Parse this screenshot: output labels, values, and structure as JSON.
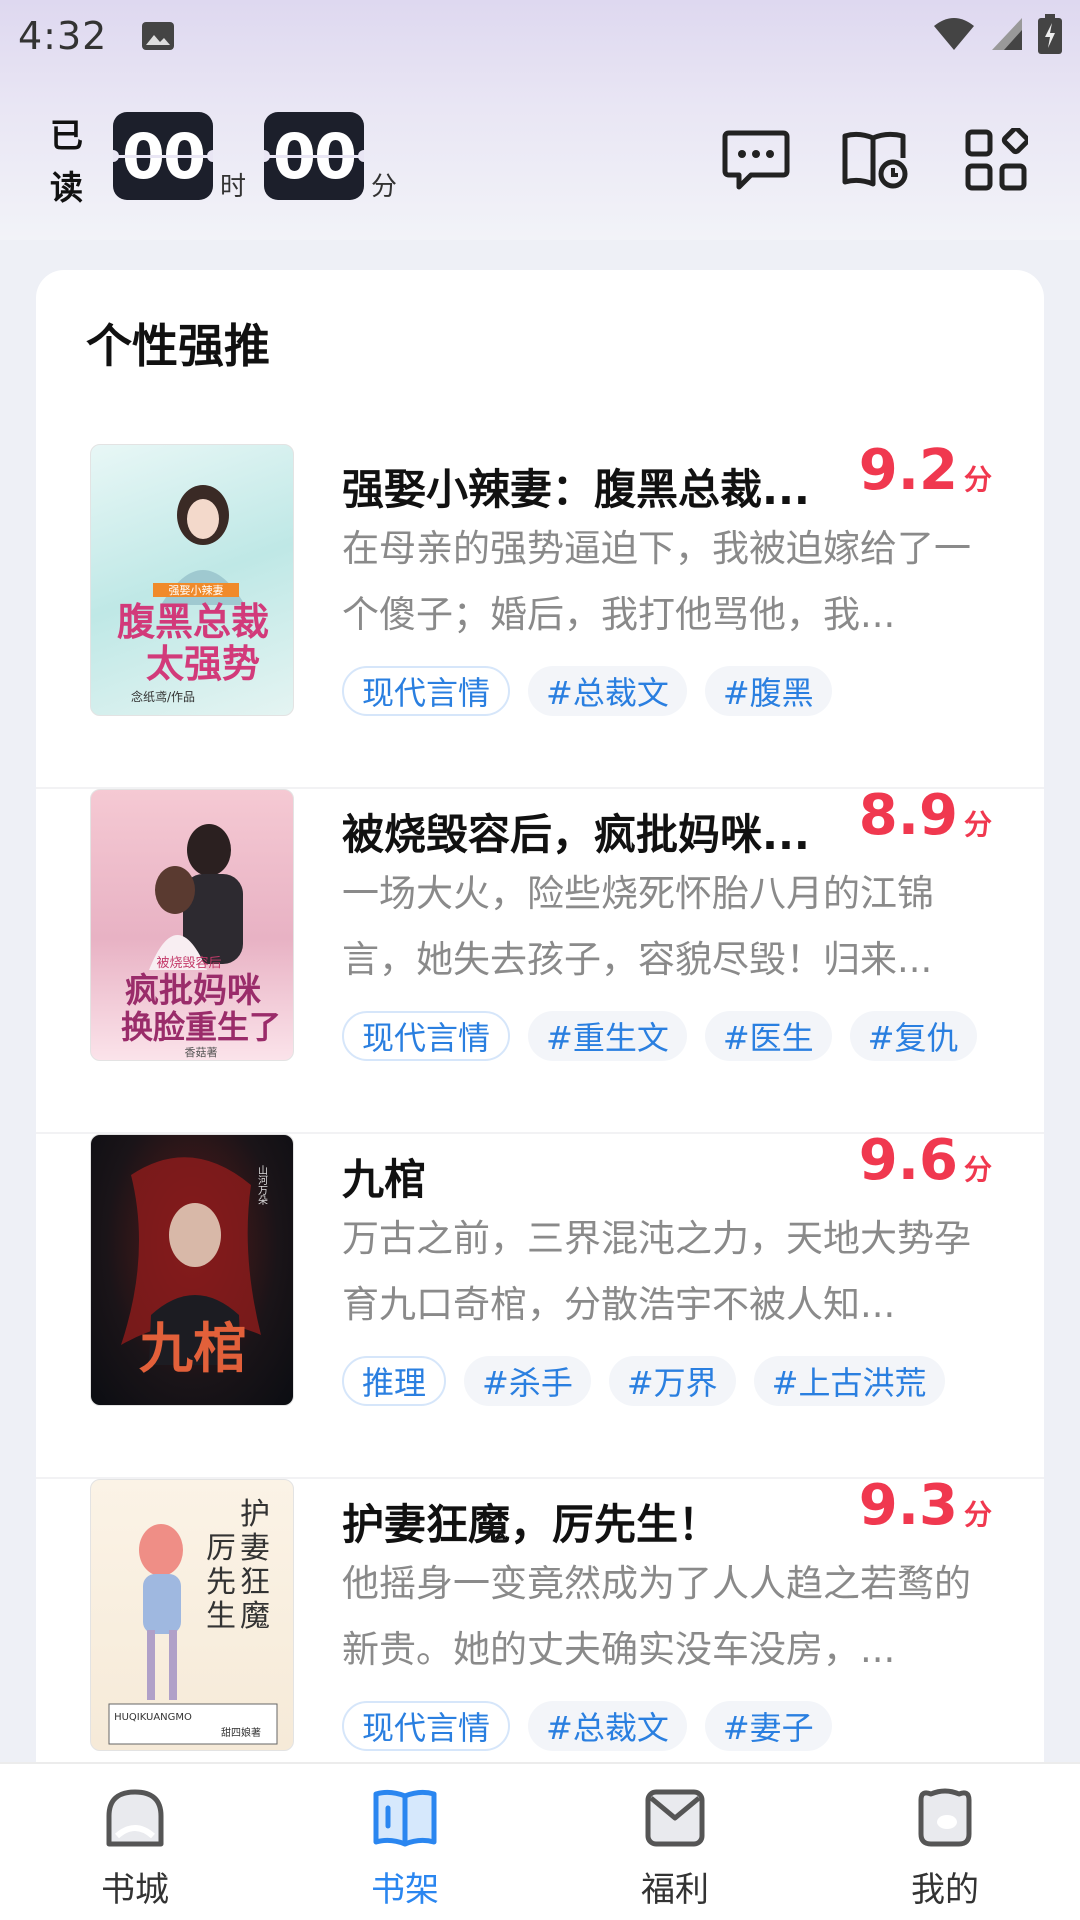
{
  "status_bar": {
    "time": "4:32",
    "icons": [
      "image-icon",
      "wifi-icon",
      "signal-icon",
      "battery-icon"
    ]
  },
  "header": {
    "read_label": "已读",
    "hours": "00",
    "hours_unit": "时",
    "minutes": "00",
    "minutes_unit": "分",
    "icons": [
      "message-icon",
      "reading-history-icon",
      "category-grid-icon"
    ]
  },
  "section": {
    "title": "个性强推"
  },
  "books": [
    {
      "title": "强娶小辣妻：腹黑总裁...",
      "score": "9.2",
      "score_unit": "分",
      "desc": "在母亲的强势逼迫下，我被迫嫁给了一个傻子；婚后，我打他骂他，我...",
      "tags": [
        "现代言情",
        "#总裁文",
        "#腹黑"
      ],
      "cover_text": "腹黑总裁太强势",
      "cover_sub": "强娶小辣妻",
      "cover_author": "念纸鸢/作品"
    },
    {
      "title": "被烧毁容后，疯批妈咪...",
      "score": "8.9",
      "score_unit": "分",
      "desc": "一场大火，险些烧死怀胎八月的江锦言，她失去孩子，容貌尽毁！归来...",
      "tags": [
        "现代言情",
        "#重生文",
        "#医生",
        "#复仇"
      ],
      "cover_text": "疯批妈咪换脸重生了",
      "cover_sub": "被烧毁容后",
      "cover_author": "香菇著"
    },
    {
      "title": "九棺",
      "score": "9.6",
      "score_unit": "分",
      "desc": "万古之前，三界混沌之力，天地大势孕育九口奇棺，分散浩宇不被人知...",
      "tags": [
        "推理",
        "#杀手",
        "#万界",
        "#上古洪荒"
      ],
      "cover_text": "九棺",
      "cover_sub": "山河万朵",
      "cover_author": ""
    },
    {
      "title": "护妻狂魔，厉先生！",
      "score": "9.3",
      "score_unit": "分",
      "desc": "他摇身一变竟然成为了人人趋之若鹜的新贵。她的丈夫确实没车没房，...",
      "tags": [
        "现代言情",
        "#总裁文",
        "#妻子"
      ],
      "cover_text": "护妻狂魔厉先生",
      "cover_sub": "HUQIKUANGMO",
      "cover_author": "甜四娘著"
    }
  ],
  "bottom_nav": [
    {
      "label": "书城",
      "icon": "bookstore-icon",
      "active": false
    },
    {
      "label": "书架",
      "icon": "bookshelf-icon",
      "active": true
    },
    {
      "label": "福利",
      "icon": "welfare-icon",
      "active": false
    },
    {
      "label": "我的",
      "icon": "profile-icon",
      "active": false
    }
  ],
  "colors": {
    "accent": "#2a86f0",
    "score": "#f0384f",
    "tag_text": "#2a7fe0"
  }
}
